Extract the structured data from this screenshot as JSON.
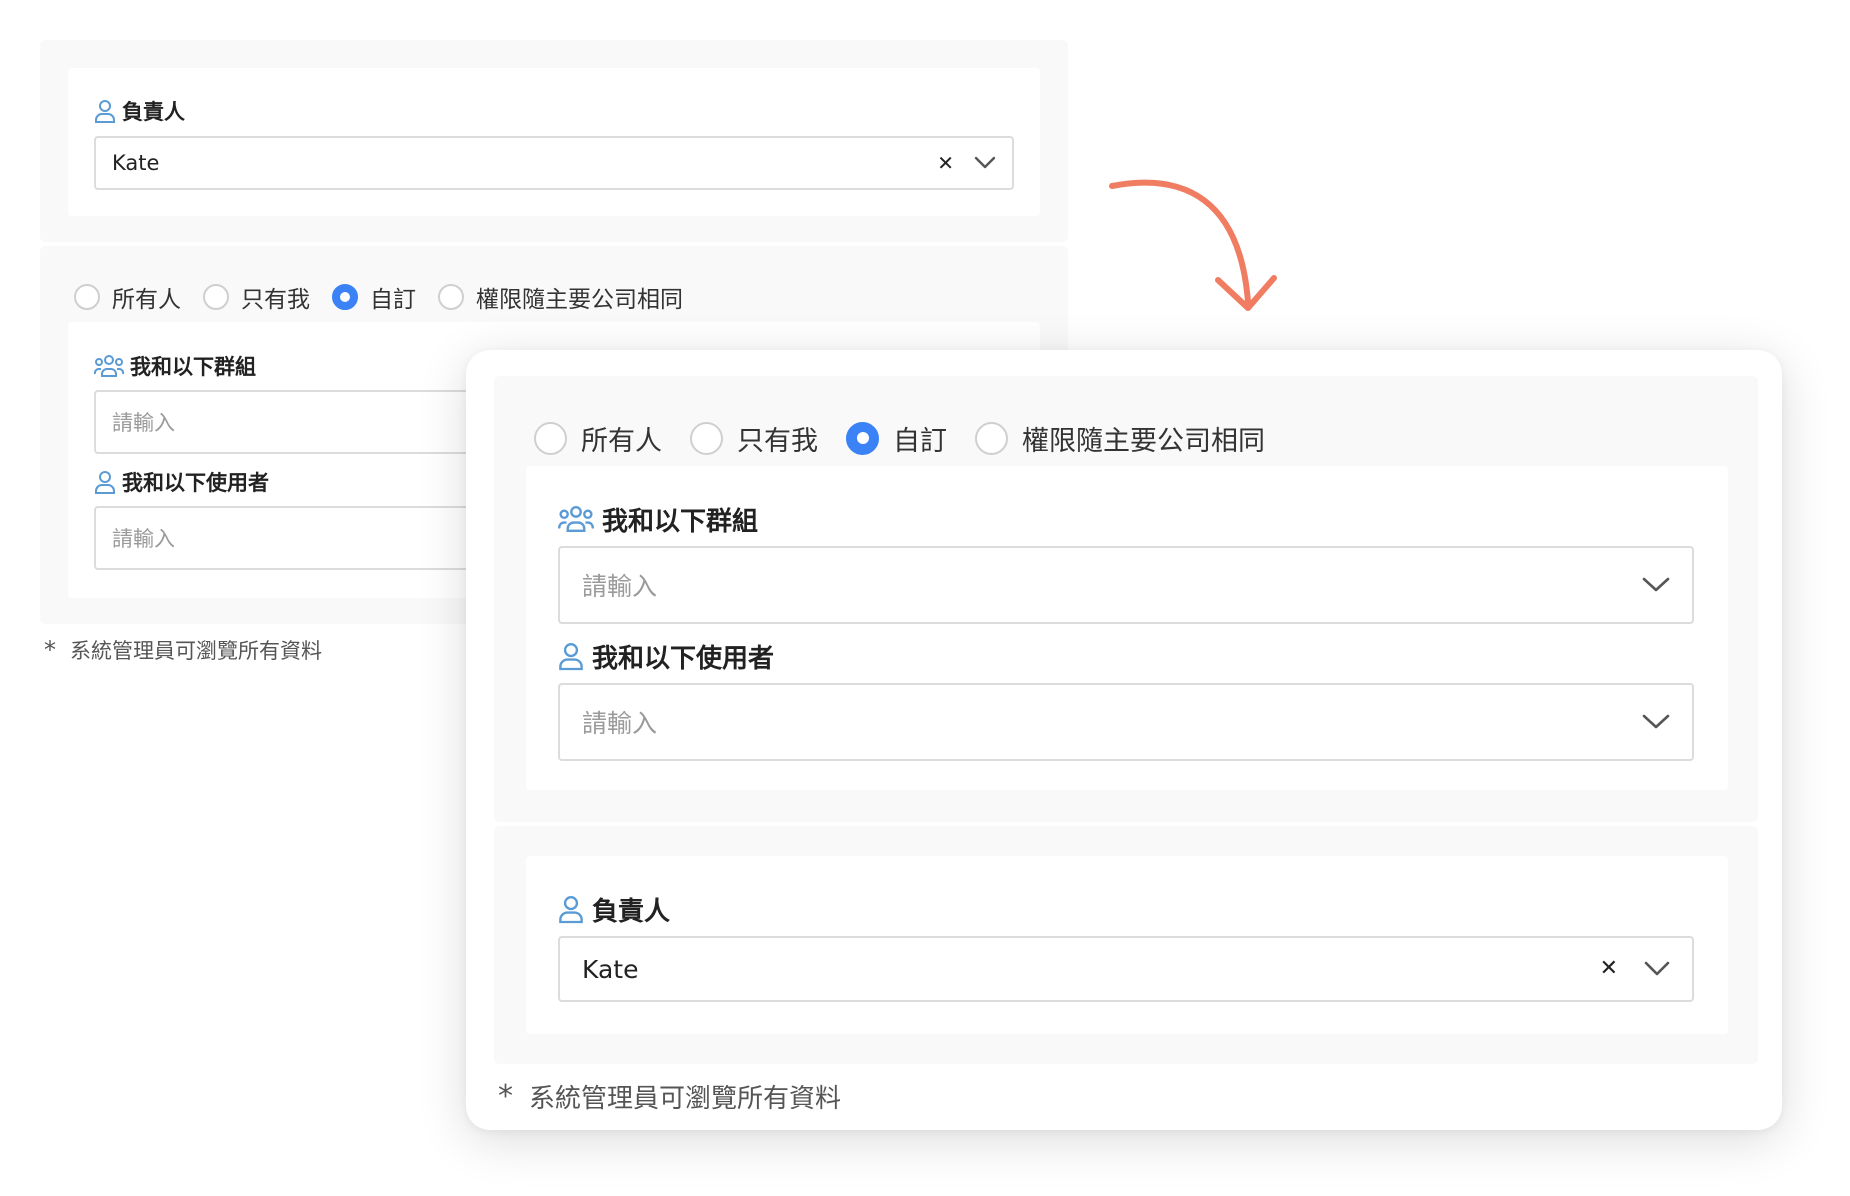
{
  "owner": {
    "label": "負責人",
    "value": "Kate",
    "clear_icon": "close-icon"
  },
  "visibility": {
    "options": [
      {
        "label": "所有人",
        "selected": false
      },
      {
        "label": "只有我",
        "selected": false
      },
      {
        "label": "自訂",
        "selected": true
      },
      {
        "label": "權限隨主要公司相同",
        "selected": false
      }
    ]
  },
  "groups": {
    "label": "我和以下群組",
    "placeholder": "請輸入"
  },
  "users": {
    "label": "我和以下使用者",
    "placeholder": "請輸入"
  },
  "note": {
    "star": "*",
    "text": "系統管理員可瀏覽所有資料"
  },
  "colors": {
    "accent": "#3b82f6",
    "icon": "#5b9bd5",
    "arrow": "#f07d62"
  }
}
